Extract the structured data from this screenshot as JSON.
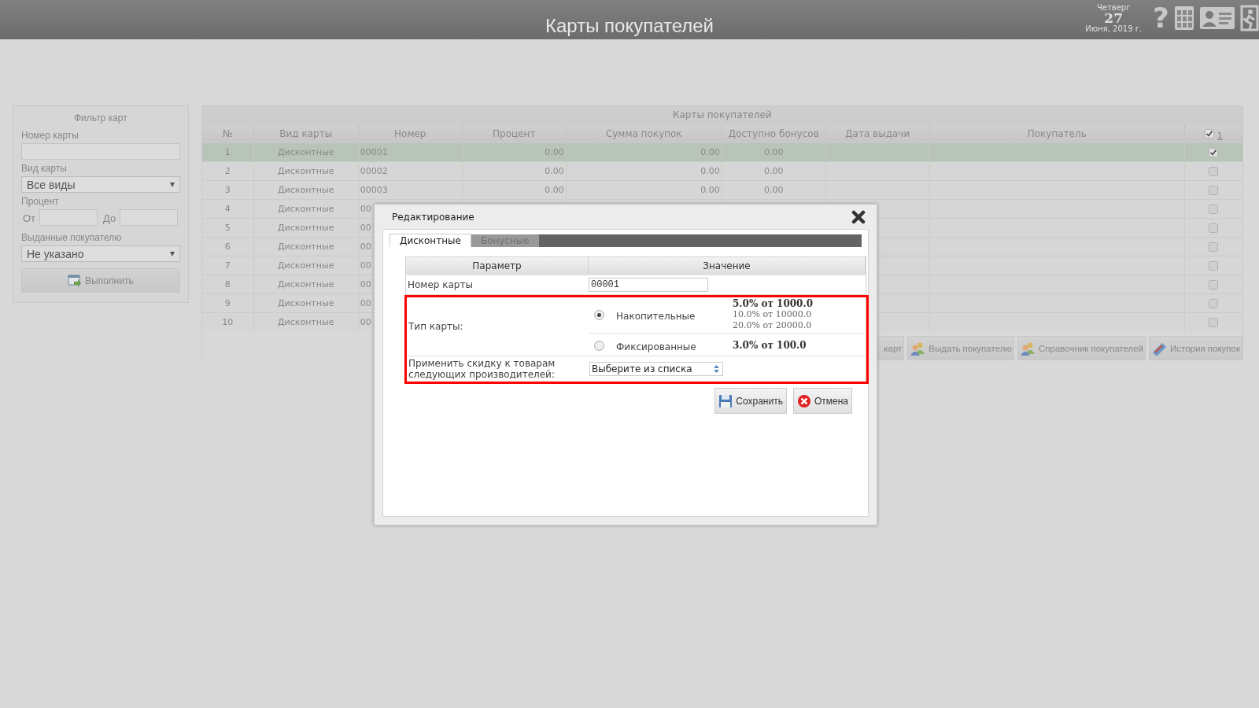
{
  "header": {
    "title": "Карты покупателей",
    "weekday": "Четверг",
    "day": "27",
    "month_year": "Июня, 2019 г.",
    "help_glyph": "?"
  },
  "filter": {
    "title": "Фильтр карт",
    "card_number_label": "Номер карты",
    "card_kind_label": "Вид карты",
    "card_kind_value": "Все виды",
    "percent_label": "Процент",
    "from_label": "От",
    "to_label": "До",
    "issued_label": "Выданные покупателю",
    "issued_value": "Не указано",
    "run_button": "Выполнить"
  },
  "table": {
    "title": "Карты покупателей",
    "columns": [
      "№",
      "Вид карты",
      "Номер",
      "Процент",
      "Сумма покупок",
      "Доступно бонусов",
      "Дата выдачи",
      "Покупатель"
    ],
    "all_checked": true,
    "checked_count": "1",
    "rows": [
      {
        "num": "1",
        "kind": "Дисконтные",
        "number": "00001",
        "percent": "0.00",
        "sum": "0.00",
        "bonus": "0.00",
        "checked": true,
        "selected": true
      },
      {
        "num": "2",
        "kind": "Дисконтные",
        "number": "00002",
        "percent": "0.00",
        "sum": "0.00",
        "bonus": "0.00",
        "checked": false,
        "selected": false
      },
      {
        "num": "3",
        "kind": "Дисконтные",
        "number": "00003",
        "percent": "0.00",
        "sum": "0.00",
        "bonus": "0.00",
        "checked": false,
        "selected": false
      },
      {
        "num": "4",
        "kind": "Дисконтные",
        "number": "00",
        "checked": false,
        "selected": false
      },
      {
        "num": "5",
        "kind": "Дисконтные",
        "number": "00",
        "checked": false,
        "selected": false
      },
      {
        "num": "6",
        "kind": "Дисконтные",
        "number": "00",
        "checked": false,
        "selected": false
      },
      {
        "num": "7",
        "kind": "Дисконтные",
        "number": "00",
        "checked": false,
        "selected": false
      },
      {
        "num": "8",
        "kind": "Дисконтные",
        "number": "00",
        "checked": false,
        "selected": false
      },
      {
        "num": "9",
        "kind": "Дисконтные",
        "number": "00",
        "checked": false,
        "selected": false
      },
      {
        "num": "10",
        "kind": "Дисконтные",
        "number": "00",
        "checked": false,
        "selected": false
      }
    ]
  },
  "actions": [
    "карт",
    "Выдать покупателю",
    "Справочник покупателей",
    "История покупок"
  ],
  "dialog": {
    "title": "Редактирование",
    "tabs": [
      {
        "label": "Дисконтные",
        "selected": true
      },
      {
        "label": "Бонусные",
        "selected": false
      }
    ],
    "columns": [
      "Параметр",
      "Значение"
    ],
    "card_number_label": "Номер карты",
    "card_number_value": "00001",
    "card_type_label": "Тип карты:",
    "card_types": [
      {
        "label": "Накопительные",
        "selected": true,
        "tiers": [
          {
            "text": "5.0% от 1000.0",
            "bold": true
          },
          {
            "text": "10.0% от 10000.0",
            "bold": false
          },
          {
            "text": "20.0% от 20000.0",
            "bold": false
          }
        ]
      },
      {
        "label": "Фиксированные",
        "selected": false,
        "tiers": [
          {
            "text": "3.0% от 100.0",
            "bold": true
          }
        ]
      }
    ],
    "manufacturers_label": "Применить скидку к товарам следующих производителей:",
    "manufacturers_value": "Выберите из списка",
    "save_button": "Сохранить",
    "cancel_button": "Отмена"
  }
}
